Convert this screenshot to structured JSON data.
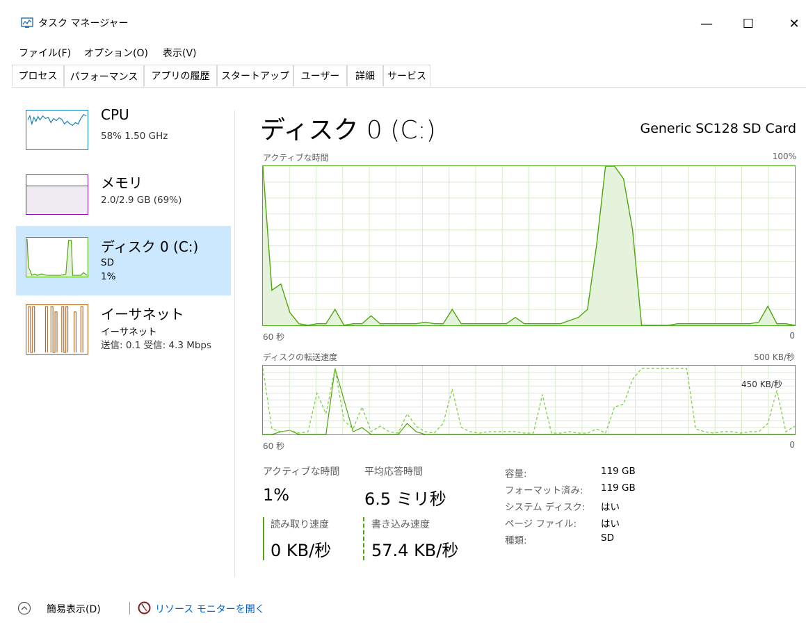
{
  "window": {
    "title": "タスク マネージャー",
    "minimize": "—",
    "maximize": "☐",
    "close": "✕"
  },
  "menu": [
    "ファイル(F)",
    "オプション(O)",
    "表示(V)"
  ],
  "tabs": [
    "プロセス",
    "パフォーマンス",
    "アプリの履歴",
    "スタートアップ",
    "ユーザー",
    "詳細",
    "サービス"
  ],
  "active_tab": "パフォーマンス",
  "sidebar": {
    "items": [
      {
        "title": "CPU",
        "sub1": "58%  1.50 GHz",
        "sub2": "",
        "color": "#117dbb"
      },
      {
        "title": "メモリ",
        "sub1": "2.0/2.9 GB (69%)",
        "sub2": "",
        "color": "#8b12ae"
      },
      {
        "title": "ディスク 0 (C:)",
        "sub1": "SD",
        "sub2": "1%",
        "color": "#4da60c"
      },
      {
        "title": "イーサネット",
        "sub1": "イーサネット",
        "sub2": "送信: 0.1  受信: 4.3 Mbps",
        "color": "#a74f01"
      }
    ]
  },
  "main": {
    "title": "ディスク 0 (C:)",
    "model": "Generic SC128 SD Card",
    "graph1": {
      "label": "アクティブな時間",
      "max": "100%",
      "time": "60 秒",
      "min": "0"
    },
    "graph2": {
      "label": "ディスクの転送速度",
      "max": "500 KB/秒",
      "inner": "450 KB/秒",
      "time": "60 秒",
      "min": "0"
    },
    "stats": {
      "active_label": "アクティブな時間",
      "active_value": "1%",
      "resp_label": "平均応答時間",
      "resp_value": "6.5 ミリ秒",
      "read_label": "読み取り速度",
      "read_value": "0 KB/秒",
      "write_label": "書き込み速度",
      "write_value": "57.4 KB/秒"
    },
    "info": [
      {
        "k": "容量:",
        "v": "119 GB"
      },
      {
        "k": "フォーマット済み:",
        "v": "119 GB"
      },
      {
        "k": "システム ディスク:",
        "v": "はい"
      },
      {
        "k": "ページ ファイル:",
        "v": "はい"
      },
      {
        "k": "種類:",
        "v": "SD"
      }
    ]
  },
  "footer": {
    "simple_view": "簡易表示(D)",
    "resource_monitor": "リソース モニターを開く"
  },
  "colors": {
    "accent_green": "#4da60c",
    "selected_bg": "#cce8ff",
    "link": "#0066cc"
  },
  "chart_data": [
    {
      "type": "area",
      "title": "アクティブな時間",
      "ylim": [
        0,
        100
      ],
      "x_range_seconds": [
        60,
        0
      ],
      "values": [
        100,
        22,
        26,
        8,
        1,
        0,
        1,
        1,
        10,
        0,
        1,
        1,
        6,
        1,
        1,
        1,
        1,
        1,
        2,
        1,
        1,
        10,
        1,
        1,
        1,
        1,
        1,
        1,
        5,
        1,
        1,
        1,
        1,
        1,
        3,
        5,
        10,
        50,
        100,
        100,
        92,
        60,
        0,
        0,
        0,
        0,
        1,
        1,
        1,
        1,
        1,
        1,
        1,
        1,
        1,
        2,
        12,
        1,
        1,
        0
      ]
    },
    {
      "type": "line",
      "title": "ディスクの転送速度",
      "ylabel": "KB/秒",
      "ylim": [
        0,
        500
      ],
      "series": [
        {
          "values": [
            0,
            0,
            20,
            30,
            0,
            0,
            0,
            0,
            480,
            250,
            20,
            50,
            0,
            0,
            0,
            0,
            80,
            20,
            0,
            0,
            0,
            0,
            0,
            0,
            0,
            0,
            0,
            0,
            0,
            0,
            0,
            0,
            0,
            0,
            0,
            0,
            0,
            0,
            0,
            0,
            0,
            0,
            0,
            0,
            0,
            0,
            0,
            0,
            0,
            0,
            0,
            0,
            0,
            0,
            0,
            0,
            0,
            0,
            0,
            0
          ]
        },
        {
          "values": [
            480,
            40,
            20,
            30,
            10,
            20,
            300,
            150,
            480,
            100,
            40,
            200,
            20,
            60,
            20,
            10,
            150,
            60,
            20,
            10,
            80,
            330,
            50,
            20,
            10,
            20,
            20,
            20,
            20,
            10,
            10,
            290,
            10,
            10,
            20,
            10,
            10,
            40,
            10,
            200,
            220,
            400,
            480,
            480,
            480,
            480,
            480,
            480,
            40,
            20,
            10,
            20,
            20,
            10,
            20,
            20,
            80,
            320,
            20,
            60
          ]
        }
      ]
    }
  ]
}
